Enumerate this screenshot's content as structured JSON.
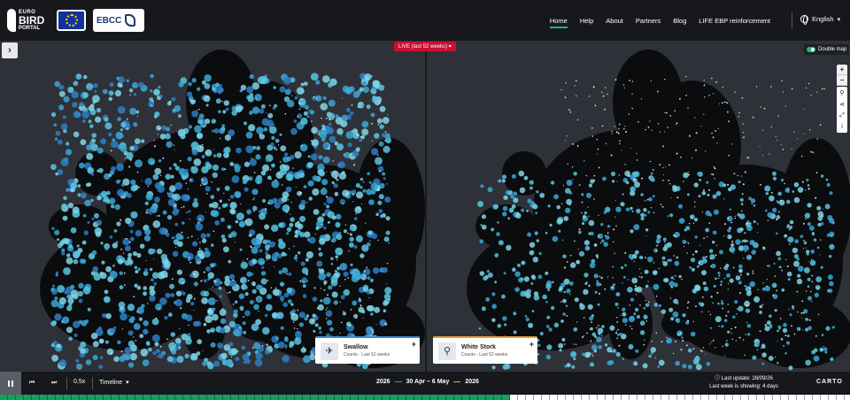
{
  "header": {
    "logo_line1": "EURO",
    "logo_line2": "BIRD",
    "logo_line3": "PORTAL",
    "ebcc_label": "EBCC",
    "nav": [
      "Home",
      "Help",
      "About",
      "Partners",
      "Blog",
      "LIFE EBP reinforcement"
    ],
    "active_nav": "Home",
    "language": "English"
  },
  "map_controls": {
    "live_label": "LIVE (last 52 weeks)",
    "double_map_label": "Double map"
  },
  "species_cards": [
    {
      "name": "Swallow",
      "subtitle": "Counts - Last 52 weeks",
      "color": "#3a8fd8"
    },
    {
      "name": "White Stork",
      "subtitle": "Counts - Last 52 weeks",
      "color": "#f0a030"
    }
  ],
  "playback": {
    "speed": "0.5x",
    "timeline_label": "Timeline",
    "year_start": "2026",
    "week_range": "30 Apr – 6 May",
    "year_end": "2026",
    "last_update": "Last update: 28/09/26",
    "last_week_showing": "Last week is showing: 4 days",
    "attribution": "CARTO",
    "progress_fraction": 0.6
  },
  "colors": {
    "accent_green": "#22b573",
    "live_red": "#c8102e",
    "swallow_blue": "#3a8fd8",
    "stork_orange": "#f0a030",
    "dot_cyan": "#5bc6e0"
  }
}
